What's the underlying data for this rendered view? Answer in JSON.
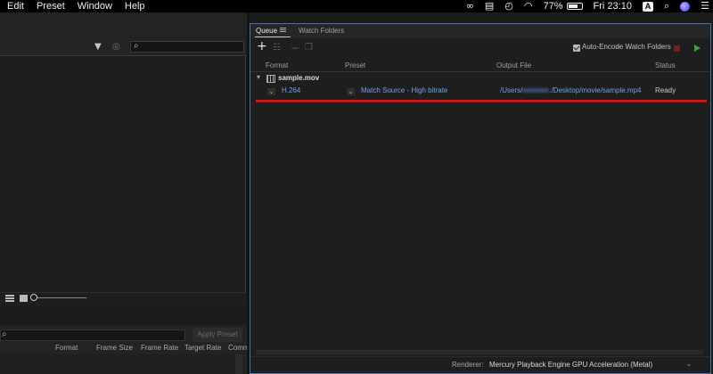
{
  "menubar": {
    "menus": [
      "Edit",
      "Preset",
      "Window",
      "Help"
    ],
    "battery_percent": "77%",
    "battery_level": 0.77,
    "clock": "Fri 23:10",
    "input_source": "A",
    "icons": [
      "creative-cloud-icon",
      "clipboard-icon",
      "time-machine-icon",
      "wifi-icon",
      "search-icon",
      "siri-icon",
      "control-center-icon"
    ]
  },
  "left_panel": {
    "apply_preset_label": "Apply Preset",
    "preset_columns": [
      "Format",
      "Frame Size",
      "Frame Rate",
      "Target Rate",
      "Comme"
    ]
  },
  "queue": {
    "tabs": [
      {
        "label": "Queue",
        "active": true
      },
      {
        "label": "Watch Folders",
        "active": false
      }
    ],
    "auto_encode_label": "Auto-Encode Watch Folders",
    "auto_encode_checked": true,
    "columns": {
      "format": "Format",
      "preset": "Preset",
      "output_file": "Output File",
      "status": "Status"
    },
    "source": {
      "name": "sample.mov"
    },
    "output": {
      "format": "H.264",
      "preset": "Match Source - High bitrate",
      "path_prefix": "/Users/",
      "path_suffix": "./Desktop/movie/sample.mp4",
      "status": "Ready"
    },
    "renderer_label": "Renderer:",
    "renderer_value": "Mercury Playback Engine GPU Acceleration (Metal)"
  },
  "colors": {
    "accent_blue": "#6fa0ea",
    "panel_border": "#4a6fb0",
    "highlight_red": "#e01010",
    "start_green": "#3aa53a"
  }
}
